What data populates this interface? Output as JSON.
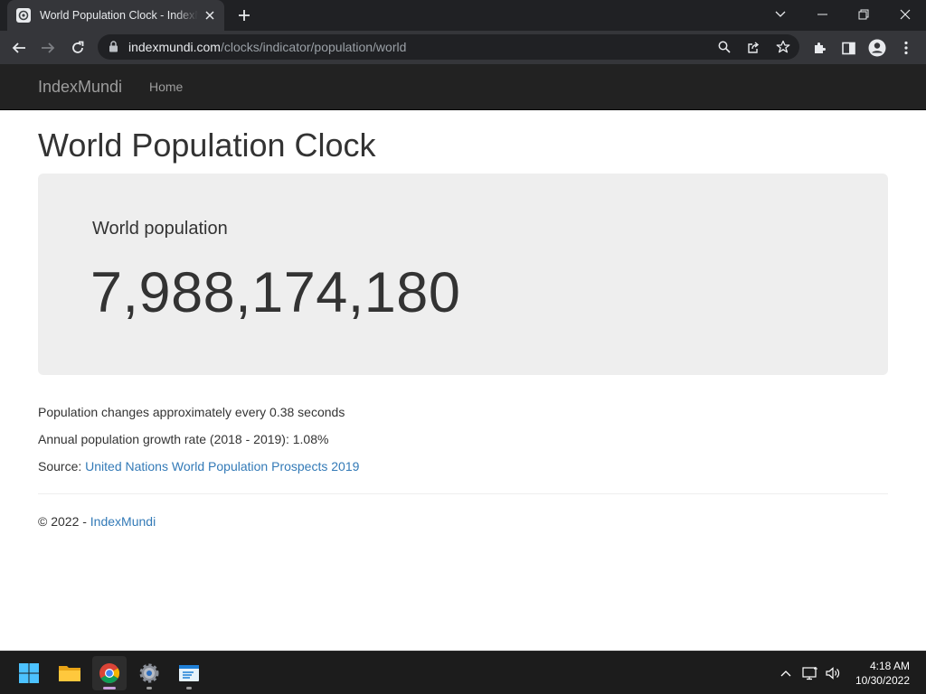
{
  "browser": {
    "tab_title": "World Population Clock - IndexMundi",
    "url_host": "indexmundi.com",
    "url_path": "/clocks/indicator/population/world",
    "icons": [
      "back-arrow-icon",
      "forward-arrow-icon",
      "reload-icon",
      "lock-icon",
      "search-icon",
      "share-icon",
      "star-icon",
      "extensions-icon",
      "side-panel-icon",
      "profile-icon",
      "more-menu-icon"
    ]
  },
  "site": {
    "brand": "IndexMundi",
    "nav": {
      "home": "Home"
    }
  },
  "page": {
    "title": "World Population Clock",
    "clock_label": "World population",
    "population_value": "7,988,174,180",
    "change_text": "Population changes approximately every 0.38 seconds",
    "growth_text": "Annual population growth rate (2018 - 2019): 1.08%",
    "source_label": "Source:",
    "source_link": "United Nations World Population Prospects 2019",
    "footer_prefix": "© 2022 -",
    "footer_link": "IndexMundi"
  },
  "colors": {
    "navbar_bg": "#222222",
    "jumbotron_bg": "#eeeeee",
    "link": "#337ab7",
    "text": "#333333"
  },
  "taskbar": {
    "apps": [
      "windows-start-icon",
      "file-explorer-icon",
      "chrome-icon",
      "settings-icon",
      "notepad-icon"
    ],
    "time": "4:18 AM",
    "date": "10/30/2022"
  }
}
